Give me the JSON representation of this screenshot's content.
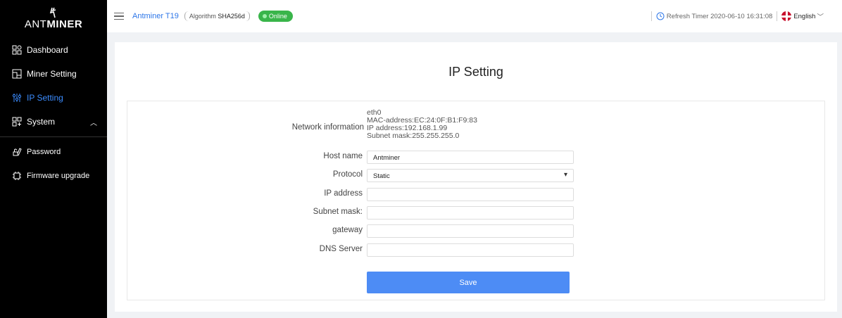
{
  "brand": {
    "text_a": "ANT",
    "text_b": "MINER"
  },
  "sidebar": {
    "items": [
      {
        "label": "Dashboard",
        "icon": "dashboard-icon"
      },
      {
        "label": "Miner Setting",
        "icon": "miner-setting-icon"
      },
      {
        "label": "IP Setting",
        "icon": "ip-setting-icon",
        "active": true
      },
      {
        "label": "System",
        "icon": "system-icon",
        "expanded": true
      },
      {
        "label": "Password",
        "icon": "password-icon"
      },
      {
        "label": "Firmware upgrade",
        "icon": "firmware-icon"
      }
    ]
  },
  "topbar": {
    "model": "Antminer T19",
    "algorithm_label": "Algorithm",
    "algorithm_value": "SHA256d",
    "status": "Online",
    "refresh_timer": "Refresh Timer 2020-06-10 16:31:08",
    "language": "English"
  },
  "page": {
    "title": "IP Setting",
    "network_label": "Network information",
    "network_info": [
      "eth0",
      "MAC-address:EC:24:0F:B1:F9:83",
      "IP address:192.168.1.99",
      "Subnet mask:255.255.255.0"
    ],
    "fields": [
      {
        "label": "Host name",
        "value": "Antminer"
      },
      {
        "label": "Protocol",
        "value": "Static"
      },
      {
        "label": "IP address",
        "value": ""
      },
      {
        "label": "Subnet mask:",
        "value": ""
      },
      {
        "label": "gateway",
        "value": ""
      },
      {
        "label": "DNS Server",
        "value": ""
      }
    ],
    "save_label": "Save"
  },
  "colors": {
    "accent": "#3b8cff",
    "online": "#39b54a",
    "save": "#4d8cf5",
    "sidebar": "#000000"
  }
}
